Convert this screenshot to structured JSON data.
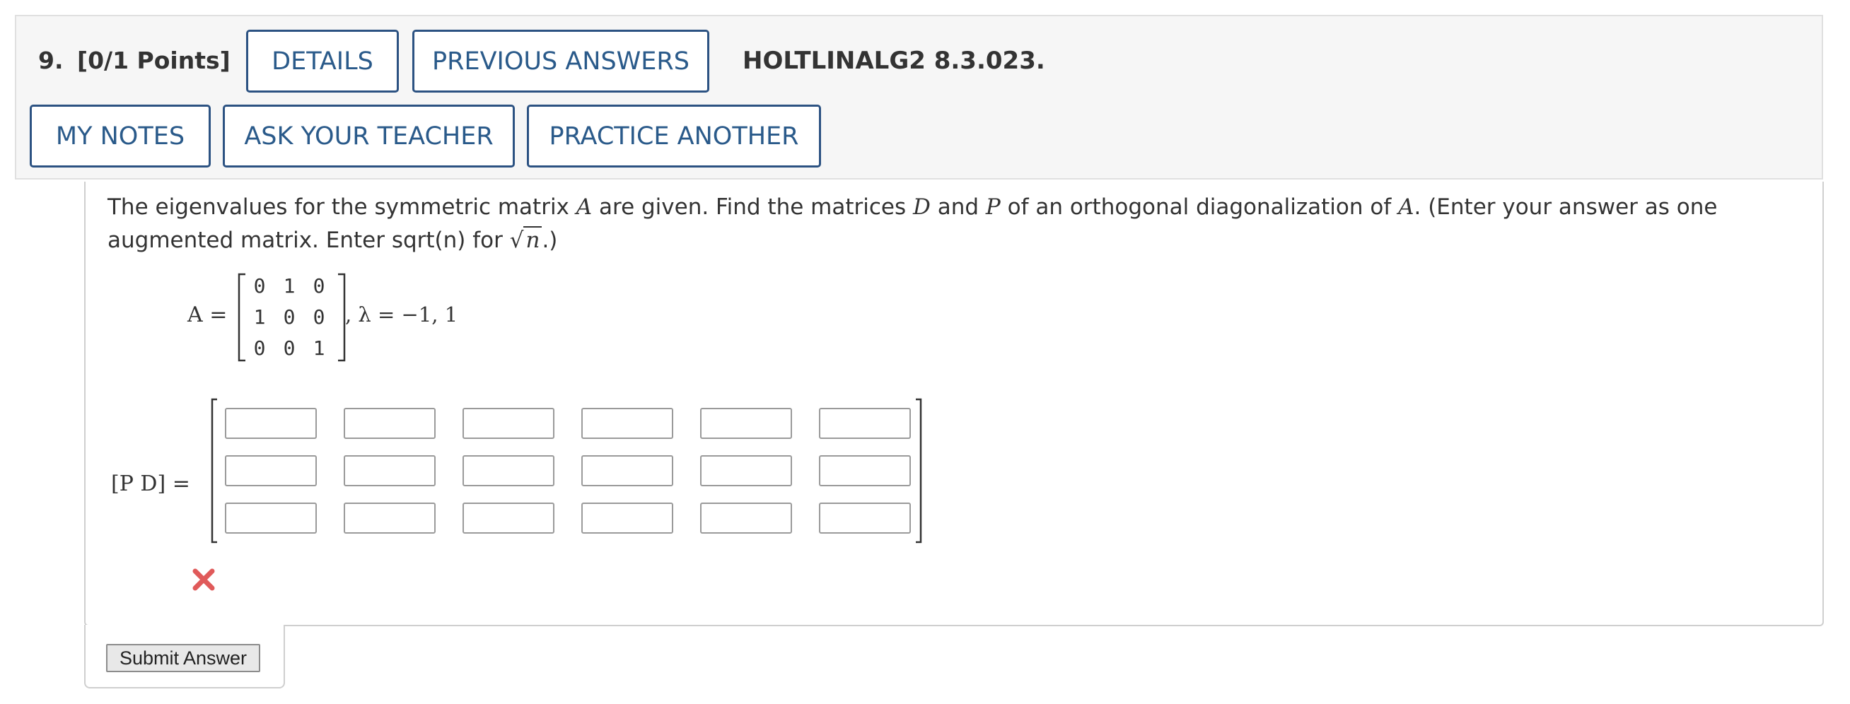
{
  "question": {
    "number": "9.",
    "points": "[0/1 Points]",
    "reference": "HOLTLINALG2 8.3.023."
  },
  "buttons": {
    "details": "DETAILS",
    "previous_answers": "PREVIOUS ANSWERS",
    "my_notes": "MY NOTES",
    "ask_teacher": "ASK YOUR TEACHER",
    "practice_another": "PRACTICE ANOTHER",
    "submit": "Submit Answer"
  },
  "prompt": {
    "t1": "The eigenvalues for the symmetric matrix ",
    "v1": "A",
    "t2": " are given. Find the matrices ",
    "v2": "D",
    "t3": " and ",
    "v3": "P",
    "t4": " of an orthogonal diagonalization of ",
    "v4": "A",
    "t5": ". (Enter your answer as one augmented matrix. Enter sqrt(n) for ",
    "radicand": "n",
    "t6": ".)"
  },
  "matrix_a": {
    "label": "A =",
    "rows": [
      [
        "0",
        "1",
        "0"
      ],
      [
        "1",
        "0",
        "0"
      ],
      [
        "0",
        "0",
        "1"
      ]
    ],
    "eigen_text": ", λ = −1, 1"
  },
  "answer": {
    "label": "[P D] =",
    "rows": 3,
    "cols": 6,
    "status": "incorrect"
  },
  "colors": {
    "button_border": "#2c5282",
    "button_text": "#2a5a8a",
    "error_mark": "#e05a5a",
    "header_bg": "#f6f6f6"
  }
}
